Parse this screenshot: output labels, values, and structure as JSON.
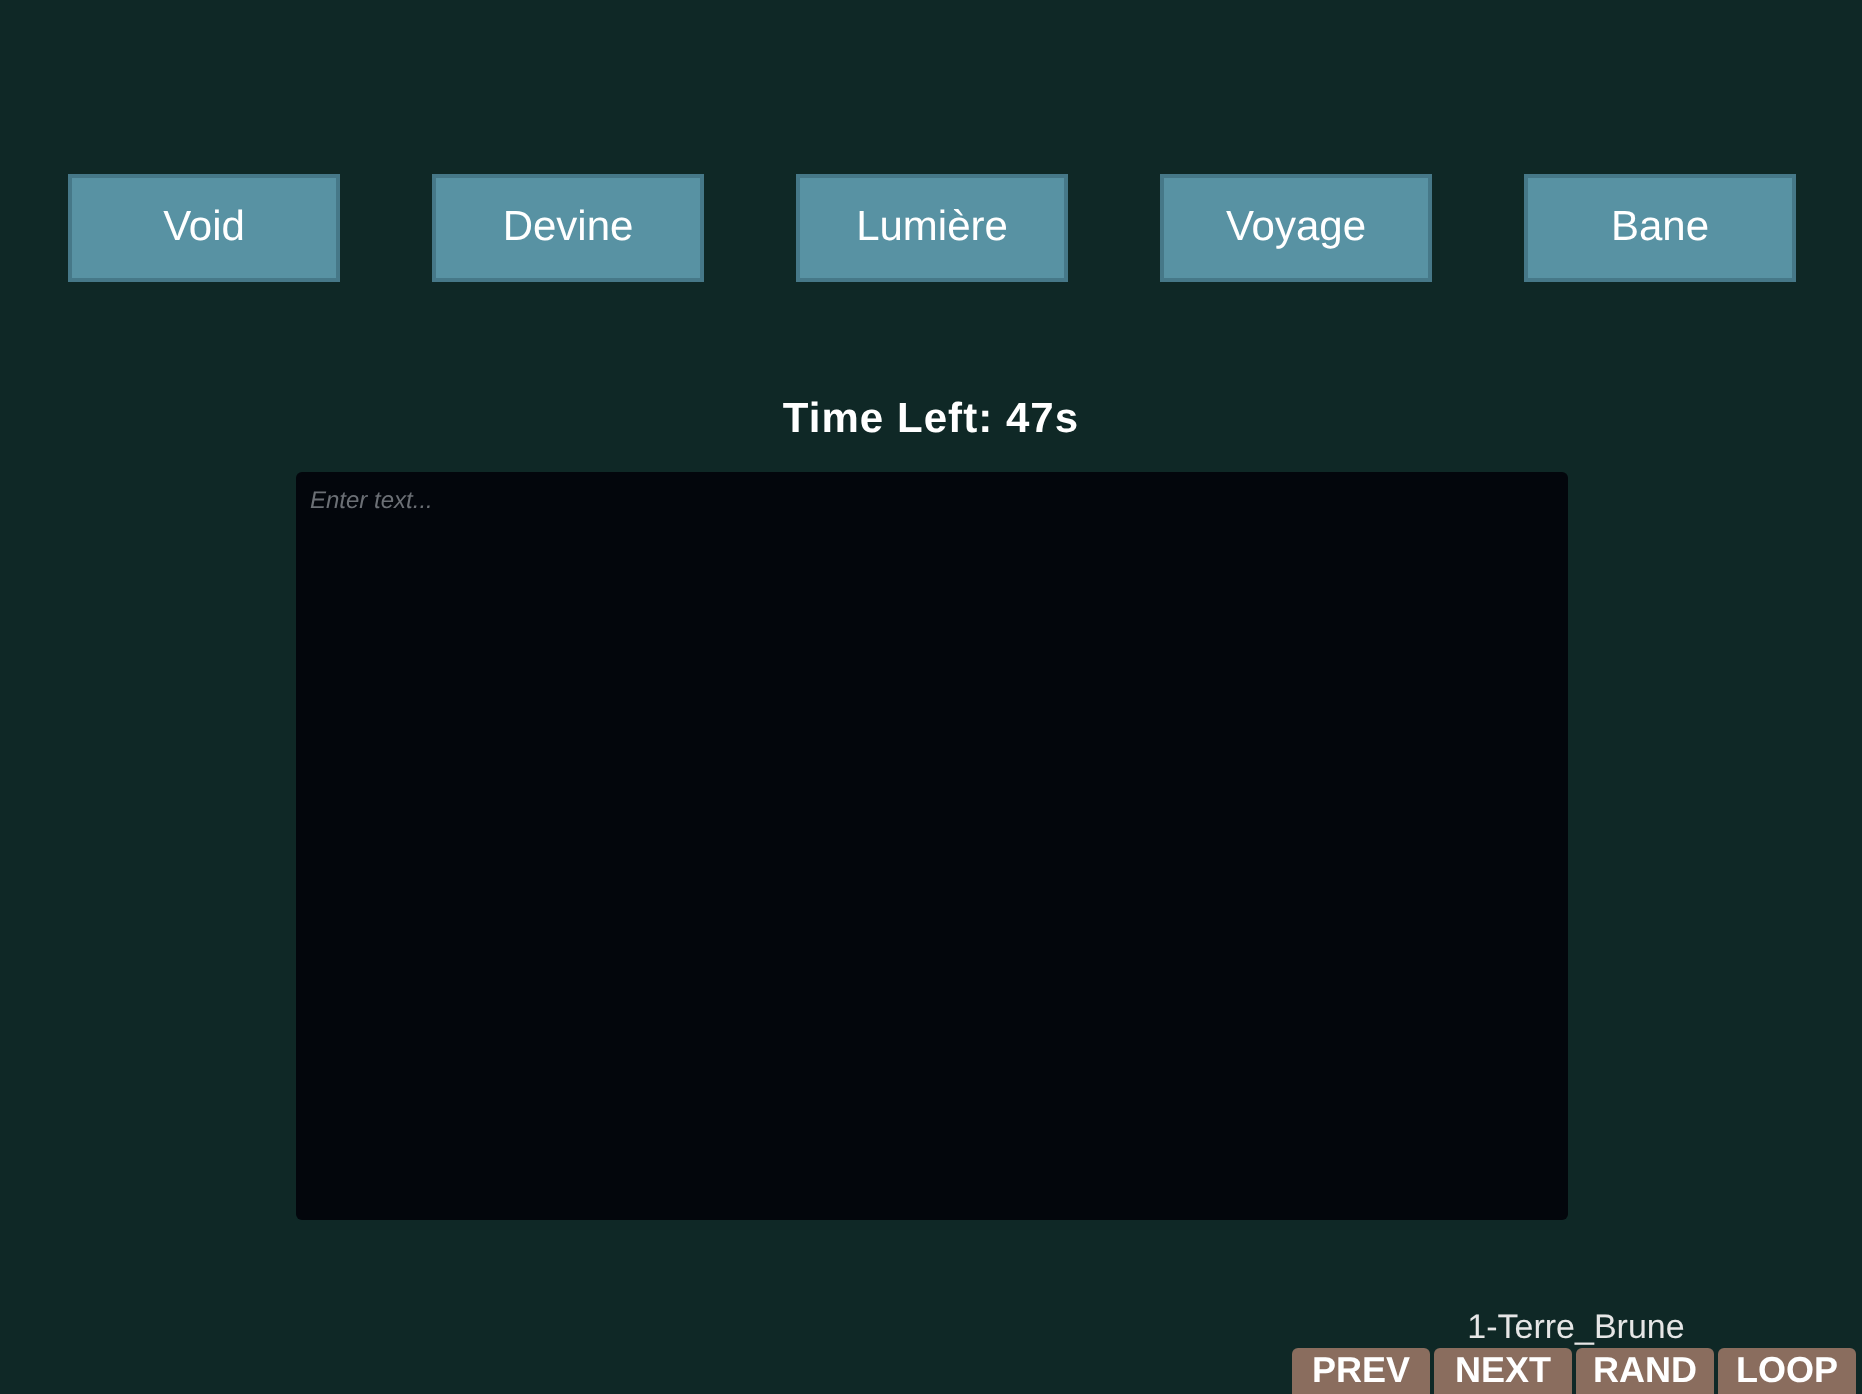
{
  "categories": [
    {
      "label": "Void"
    },
    {
      "label": "Devine"
    },
    {
      "label": "Lumière"
    },
    {
      "label": "Voyage"
    },
    {
      "label": "Bane"
    }
  ],
  "timer": "Time Left: 47s",
  "editor": {
    "placeholder": "Enter text..."
  },
  "track": "1-Terre_Brune",
  "controls": [
    {
      "label": "PREV"
    },
    {
      "label": "NEXT"
    },
    {
      "label": "RAND"
    },
    {
      "label": "LOOP"
    }
  ]
}
